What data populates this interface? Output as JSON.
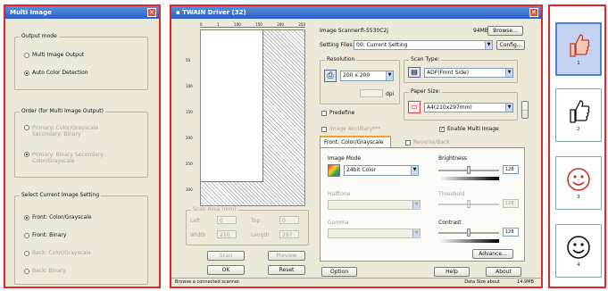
{
  "multi": {
    "title": "Multi Image",
    "output_mode": {
      "label": "Output mode",
      "options": [
        {
          "label": "Multi Image Output",
          "selected": false
        },
        {
          "label": "Auto Color Detection",
          "selected": true
        }
      ]
    },
    "order": {
      "label": "Order (for Multi Image Output)",
      "options": [
        "Primary: Color/Grayscale Secondary: Binary",
        "Primary: Binary Secondary: Color/Grayscale"
      ]
    },
    "current": {
      "label": "Select Current Image Setting",
      "options": [
        {
          "label": "Front: Color/Grayscale",
          "selected": true,
          "enabled": true
        },
        {
          "label": "Front: Binary",
          "selected": false,
          "enabled": true
        },
        {
          "label": "Back: Color/Grayscale",
          "selected": false,
          "enabled": false
        },
        {
          "label": "Back: Binary",
          "selected": false,
          "enabled": false
        }
      ]
    }
  },
  "driver": {
    "title": "TWAIN Driver (32)",
    "ruler_top": [
      "0",
      "1",
      "100",
      "150",
      "200",
      "250"
    ],
    "ruler_left": [
      "50",
      "100",
      "150",
      "200",
      "250",
      "300"
    ],
    "image_scanner_label": "Image Scanner:",
    "image_scanner_value": "fi-5530C2j",
    "size_value": "94MB",
    "browse_label": "Browse...",
    "setting_files_label": "Setting Files:",
    "setting_files_value": "00: Current Setting",
    "config_label": "Config...",
    "resolution_label": "Resolution",
    "resolution_value": "200 x 200",
    "dpi_label": "dpi",
    "predefine_label": "Predefine",
    "scan_type_label": "Scan Type:",
    "scan_type_value": "ADF(Front Side)",
    "paper_size_label": "Paper Size:",
    "paper_size_value": "A4(210x297mm)",
    "enable_multi_label": "Enable Multi Image",
    "enable_multi_checked": true,
    "disabled_check_label": "Image Ancilliary***",
    "tab_front": "Front: Color/Grayscale",
    "tab_disabled_check": "Reverse/Back",
    "image_mode_label": "Image Mode",
    "image_mode_value": "24bit Color",
    "halftone_label": "Halftone",
    "gamma_label": "Gamma",
    "brightness_label": "Brightness",
    "brightness_value": "128",
    "threshold_label": "Threshold",
    "threshold_value": "128",
    "contrast_label": "Contrast",
    "contrast_value": "128",
    "advance_label": "Advance...",
    "scan_area_label": "Scan Area (mm)",
    "left_label": "Left",
    "top_label": "Top",
    "width_label": "Width",
    "length_label": "Length",
    "scan_area_values": [
      "0",
      "0",
      "210",
      "297"
    ],
    "scan_label": "Scan",
    "preview_label": "Preview",
    "ok_label": "OK",
    "reset_label": "Reset",
    "option_label": "Option",
    "help_label": "Help",
    "about_label": "About",
    "status_text": "Browse a connected scanner.",
    "data_size_label": "Data Size about",
    "data_size_value": "14.9MB"
  },
  "thumbs": [
    {
      "caption": "1",
      "icon": "thumbs-up-red-icon"
    },
    {
      "caption": "2",
      "icon": "thumbs-up-bw-icon"
    },
    {
      "caption": "3",
      "icon": "smiley-red-icon"
    },
    {
      "caption": "4",
      "icon": "smiley-bw-icon"
    }
  ],
  "colors": {
    "frame": "#e02828",
    "titlebar": "#2a5fc8",
    "dialog_bg": "#ece9d8",
    "selected_thumb": "#c4d3f2"
  }
}
